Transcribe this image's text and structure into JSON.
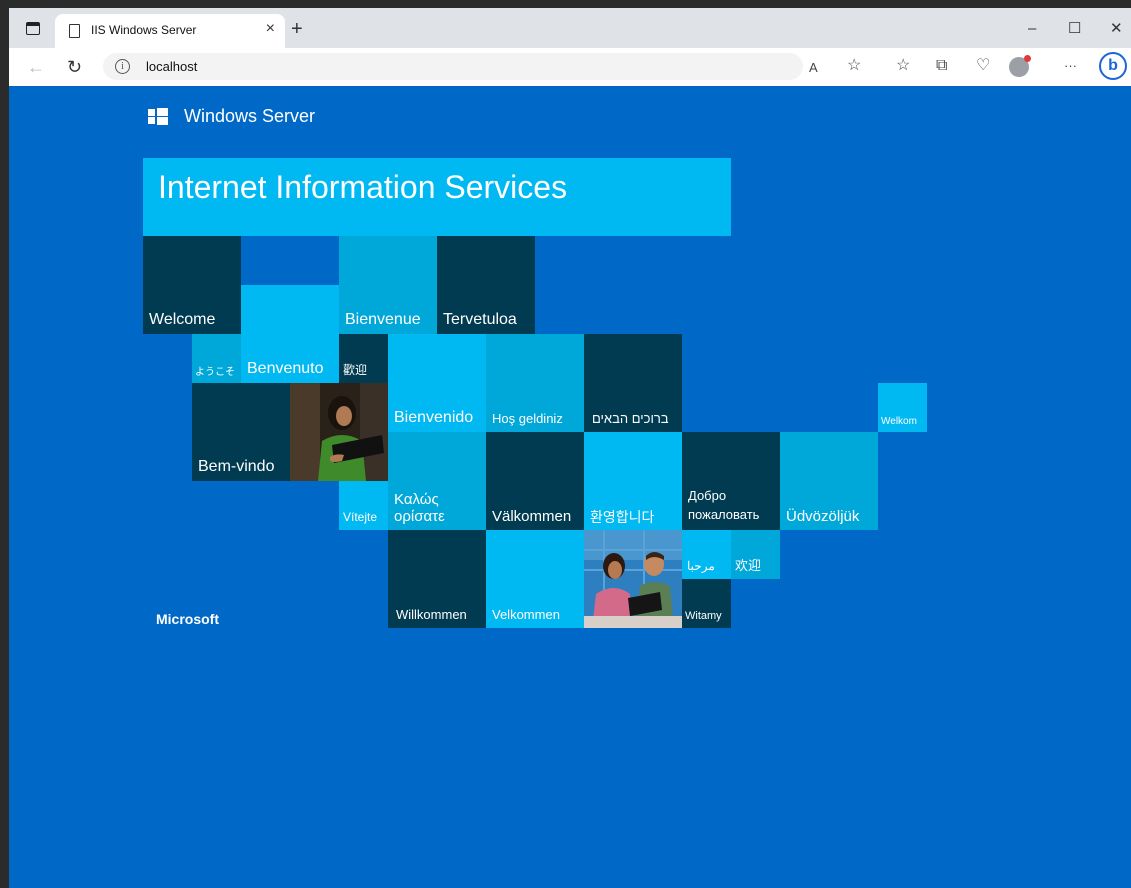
{
  "browser": {
    "tab_title": "IIS Windows Server",
    "tab_close": "×",
    "new_tab": "+",
    "url": "localhost",
    "window_controls": {
      "minimize": "–",
      "maximize": "☐",
      "close": "✕"
    },
    "toolbar_icons": [
      "back-icon",
      "refresh-icon",
      "read-aloud-icon",
      "favorite-icon",
      "favorites-icon",
      "collections-icon",
      "extensions-icon",
      "profile-icon",
      "more-icon",
      "bing-icon"
    ],
    "glyphs": {
      "back": "←",
      "refresh": "↻",
      "read_aloud": "A",
      "favorite": "☆",
      "favorites": "☆",
      "collections": "⧉",
      "health": "♡",
      "more": "···",
      "bing": "b",
      "info": "i"
    }
  },
  "page": {
    "brand": "Windows Server",
    "banner_title": "Internet Information Services",
    "footer_brand": "Microsoft",
    "welcome_tiles": [
      "Welcome",
      "Bienvenue",
      "Tervetuloa",
      "ようこそ",
      "Benvenuto",
      "歡迎",
      "Bienvenido",
      "Hoş geldiniz",
      "ברוכים הבאים",
      "Welkom",
      "Bem-vindo",
      "Vítejte",
      "Καλώς ορίσατε",
      "Välkommen",
      "환영합니다",
      "Добро пожаловать",
      "Üdvözöljük",
      "Willkommen",
      "Velkommen",
      "مرحبا",
      "欢迎",
      "Witamy"
    ]
  },
  "colors": {
    "page_bg": "#0069c8",
    "banner": "#00b9f2",
    "tile_dark": "#003b51",
    "tile_mid": "#00a7d9",
    "tile_light": "#00b9f2"
  }
}
